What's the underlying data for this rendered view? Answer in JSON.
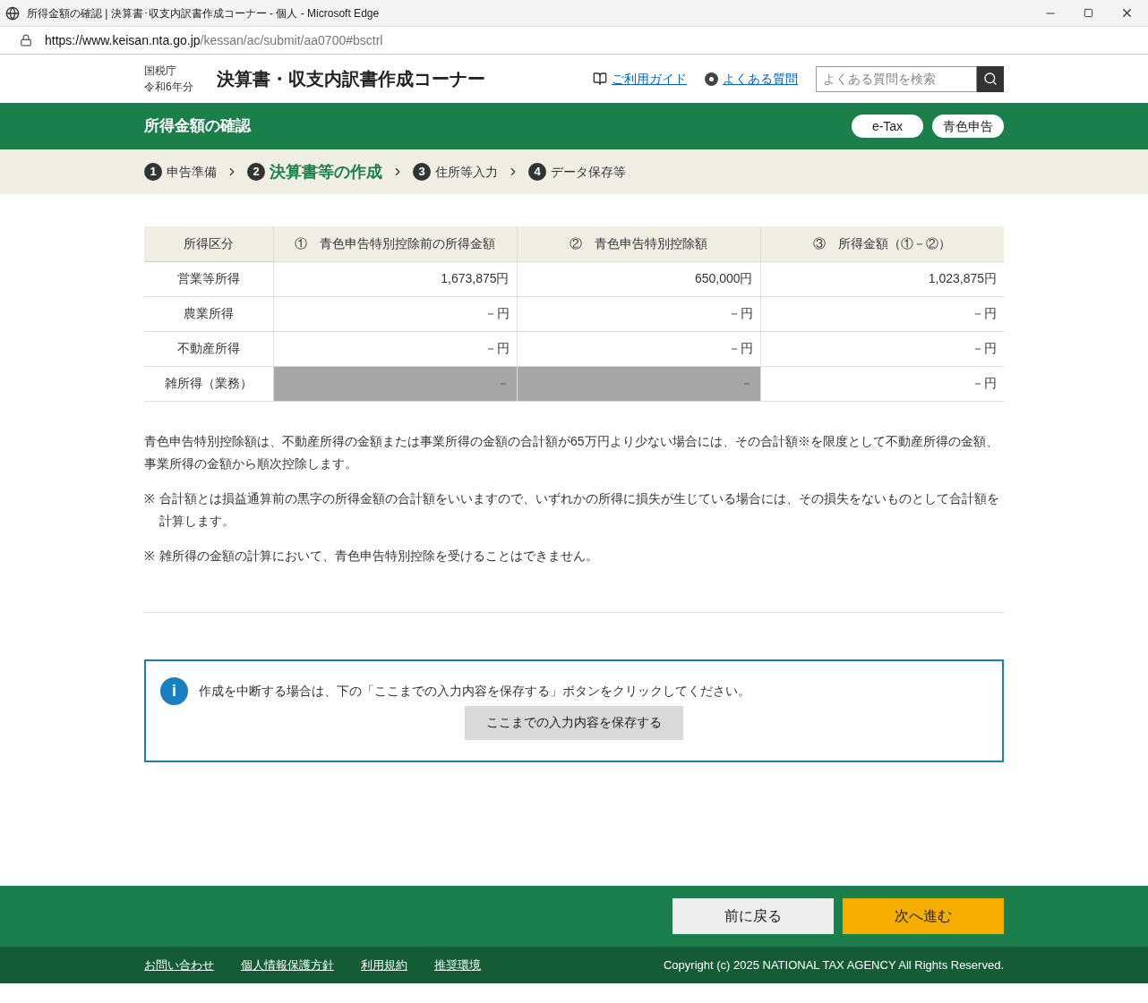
{
  "window": {
    "title": "所得金額の確認 | 決算書･収支内訳書作成コーナー - 個人 - Microsoft Edge",
    "url_host": "https://www.keisan.nta.go.jp",
    "url_path": "/kessan/ac/submit/aa0700#bsctrl"
  },
  "header": {
    "agency": "国税庁",
    "year": "令和6年分",
    "site_title": "決算書・収支内訳書作成コーナー",
    "links": [
      "ご利用ガイド",
      "よくある質問"
    ],
    "search": {
      "placeholder": "よくある質問を検索"
    }
  },
  "page_bar": {
    "title": "所得金額の確認",
    "badges": [
      "e-Tax",
      "青色申告"
    ]
  },
  "steps": [
    {
      "number": "1",
      "label": "申告準備",
      "selected": false
    },
    {
      "number": "2",
      "label": "決算書等の作成",
      "selected": true
    },
    {
      "number": "3",
      "label": "住所等入力",
      "selected": false
    },
    {
      "number": "4",
      "label": "データ保存等",
      "selected": false
    }
  ],
  "table": {
    "columns": [
      "所得区分",
      "①　青色申告特別控除前の所得金額",
      "②　青色申告特別控除額",
      "③　所得金額（①－②）"
    ],
    "rows": [
      {
        "cells": [
          {
            "text": "営業等所得",
            "disabled": false
          },
          {
            "text": "1,673,875円",
            "disabled": false
          },
          {
            "text": "650,000円",
            "disabled": false
          },
          {
            "text": "1,023,875円",
            "disabled": false
          }
        ]
      },
      {
        "cells": [
          {
            "text": "農業所得",
            "disabled": false
          },
          {
            "text": "－円",
            "disabled": false
          },
          {
            "text": "－円",
            "disabled": false
          },
          {
            "text": "－円",
            "disabled": false
          }
        ]
      },
      {
        "cells": [
          {
            "text": "不動産所得",
            "disabled": false
          },
          {
            "text": "－円",
            "disabled": false
          },
          {
            "text": "－円",
            "disabled": false
          },
          {
            "text": "－円",
            "disabled": false
          }
        ]
      },
      {
        "cells": [
          {
            "text": "雑所得（業務）",
            "disabled": false
          },
          {
            "text": "－",
            "disabled": true
          },
          {
            "text": "－",
            "disabled": true
          },
          {
            "text": "－円",
            "disabled": false
          }
        ]
      }
    ]
  },
  "notes": {
    "paragraph": "青色申告特別控除額は、不動産所得の金額または事業所得の金額の合計額が65万円より少ない場合には、その合計額※を限度として不動産所得の金額、事業所得の金額から順次控除します。",
    "items": [
      {
        "mark": "※",
        "text": "合計額とは損益通算前の黒字の所得金額の合計額をいいますので、いずれかの所得に損失が生じている場合には、その損失をないものとして合計額を計算します。"
      },
      {
        "mark": "※",
        "text": "雑所得の金額の計算において、青色申告特別控除を受けることはできません。"
      }
    ]
  },
  "info_box": {
    "icon_text": "i",
    "message": "作成を中断する場合は、下の「ここまでの入力内容を保存する」ボタンをクリックしてください。",
    "button": "ここまでの入力内容を保存する"
  },
  "nav_buttons": {
    "back": "前に戻る",
    "next": "次へ進む"
  },
  "footer": {
    "links": [
      "お問い合わせ",
      "個人情報保護方針",
      "利用規約",
      "推奨環境"
    ],
    "copyright": "Copyright (c) 2025 NATIONAL TAX AGENCY All Rights Reserved."
  }
}
